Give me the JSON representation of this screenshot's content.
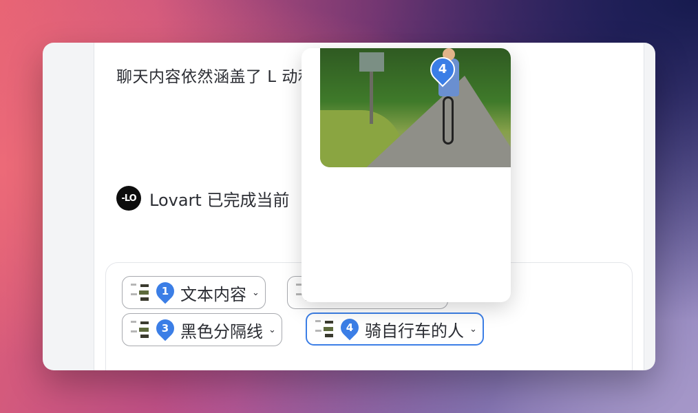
{
  "message": {
    "text": "聊天内容依然涵盖了 L                                          动和优势特点。"
  },
  "status": {
    "logo_text": "-LO",
    "text": "Lovart 已完成当前"
  },
  "chips": [
    {
      "number": "1",
      "label": "文本内容",
      "icon": "image-thumbnail"
    },
    {
      "number": "",
      "label": "",
      "icon": "image-thumbnail"
    },
    {
      "number": "3",
      "label": "黑色分隔线",
      "icon": "image-thumbnail"
    },
    {
      "number": "4",
      "label": "骑自行车的人",
      "icon": "image-thumbnail"
    }
  ],
  "chip_chevron": "⌄",
  "popover": {
    "pin_number": "4",
    "image_icon": "cyclist-photo"
  },
  "colors": {
    "accent": "#3b7ee6",
    "text": "#2b2d33"
  }
}
